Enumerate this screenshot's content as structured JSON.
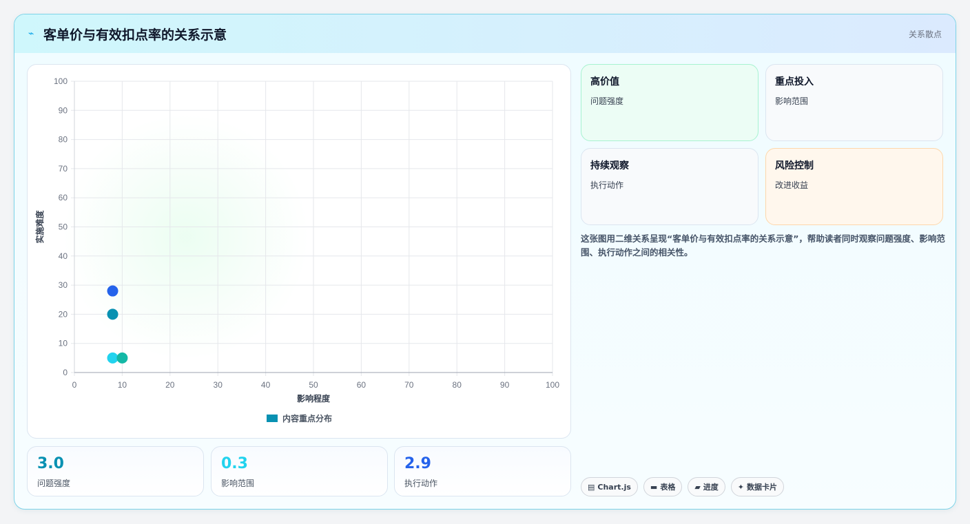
{
  "header": {
    "icon": "bolt-icon",
    "title": "客单价与有效扣点率的关系示意",
    "tag": "关系散点"
  },
  "chart_data": {
    "type": "scatter",
    "title": "",
    "xlabel": "影响程度",
    "ylabel": "实施难度",
    "xlim": [
      0,
      100
    ],
    "ylim": [
      0,
      100
    ],
    "xticks": [
      0,
      10,
      20,
      30,
      40,
      50,
      60,
      70,
      80,
      90,
      100
    ],
    "yticks": [
      0,
      10,
      20,
      30,
      40,
      50,
      60,
      70,
      80,
      90,
      100
    ],
    "grid": true,
    "legend_position": "bottom",
    "series": [
      {
        "name": "内容重点分布",
        "color": "#0891b2",
        "points": [
          {
            "x": 8,
            "y": 28,
            "color": "#2563eb"
          },
          {
            "x": 8,
            "y": 20,
            "color": "#0891b2"
          },
          {
            "x": 8,
            "y": 5,
            "color": "#22d3ee"
          },
          {
            "x": 10,
            "y": 5,
            "color": "#14b8a6"
          }
        ]
      }
    ]
  },
  "stats": [
    {
      "value": "3.0",
      "label": "问题强度",
      "color": "#0891b2"
    },
    {
      "value": "0.3",
      "label": "影响范围",
      "color": "#22d3ee"
    },
    {
      "value": "2.9",
      "label": "执行动作",
      "color": "#2563eb"
    }
  ],
  "quadrants": [
    {
      "title": "高价值",
      "sub": "问题强度",
      "bg": "#ecfdf5",
      "border": "#a7f3d0"
    },
    {
      "title": "重点投入",
      "sub": "影响范围",
      "bg": "#f8fafc",
      "border": "#dbe5f0"
    },
    {
      "title": "持续观察",
      "sub": "执行动作",
      "bg": "#f8fafc",
      "border": "#dbe5f0"
    },
    {
      "title": "风险控制",
      "sub": "改进收益",
      "bg": "#fff7ed",
      "border": "#fed7aa"
    }
  ],
  "description": "这张图用二维关系呈现“客单价与有效扣点率的关系示意”，帮助读者同时观察问题强度、影响范围、执行动作之间的相关性。",
  "chips": [
    {
      "icon": "chart-icon",
      "glyph": "▤",
      "label": "Chart.js"
    },
    {
      "icon": "table-icon",
      "glyph": "▬",
      "label": "表格"
    },
    {
      "icon": "progress-icon",
      "glyph": "▰",
      "label": "进度"
    },
    {
      "icon": "sparkle-icon",
      "glyph": "✦",
      "label": "数据卡片"
    }
  ]
}
